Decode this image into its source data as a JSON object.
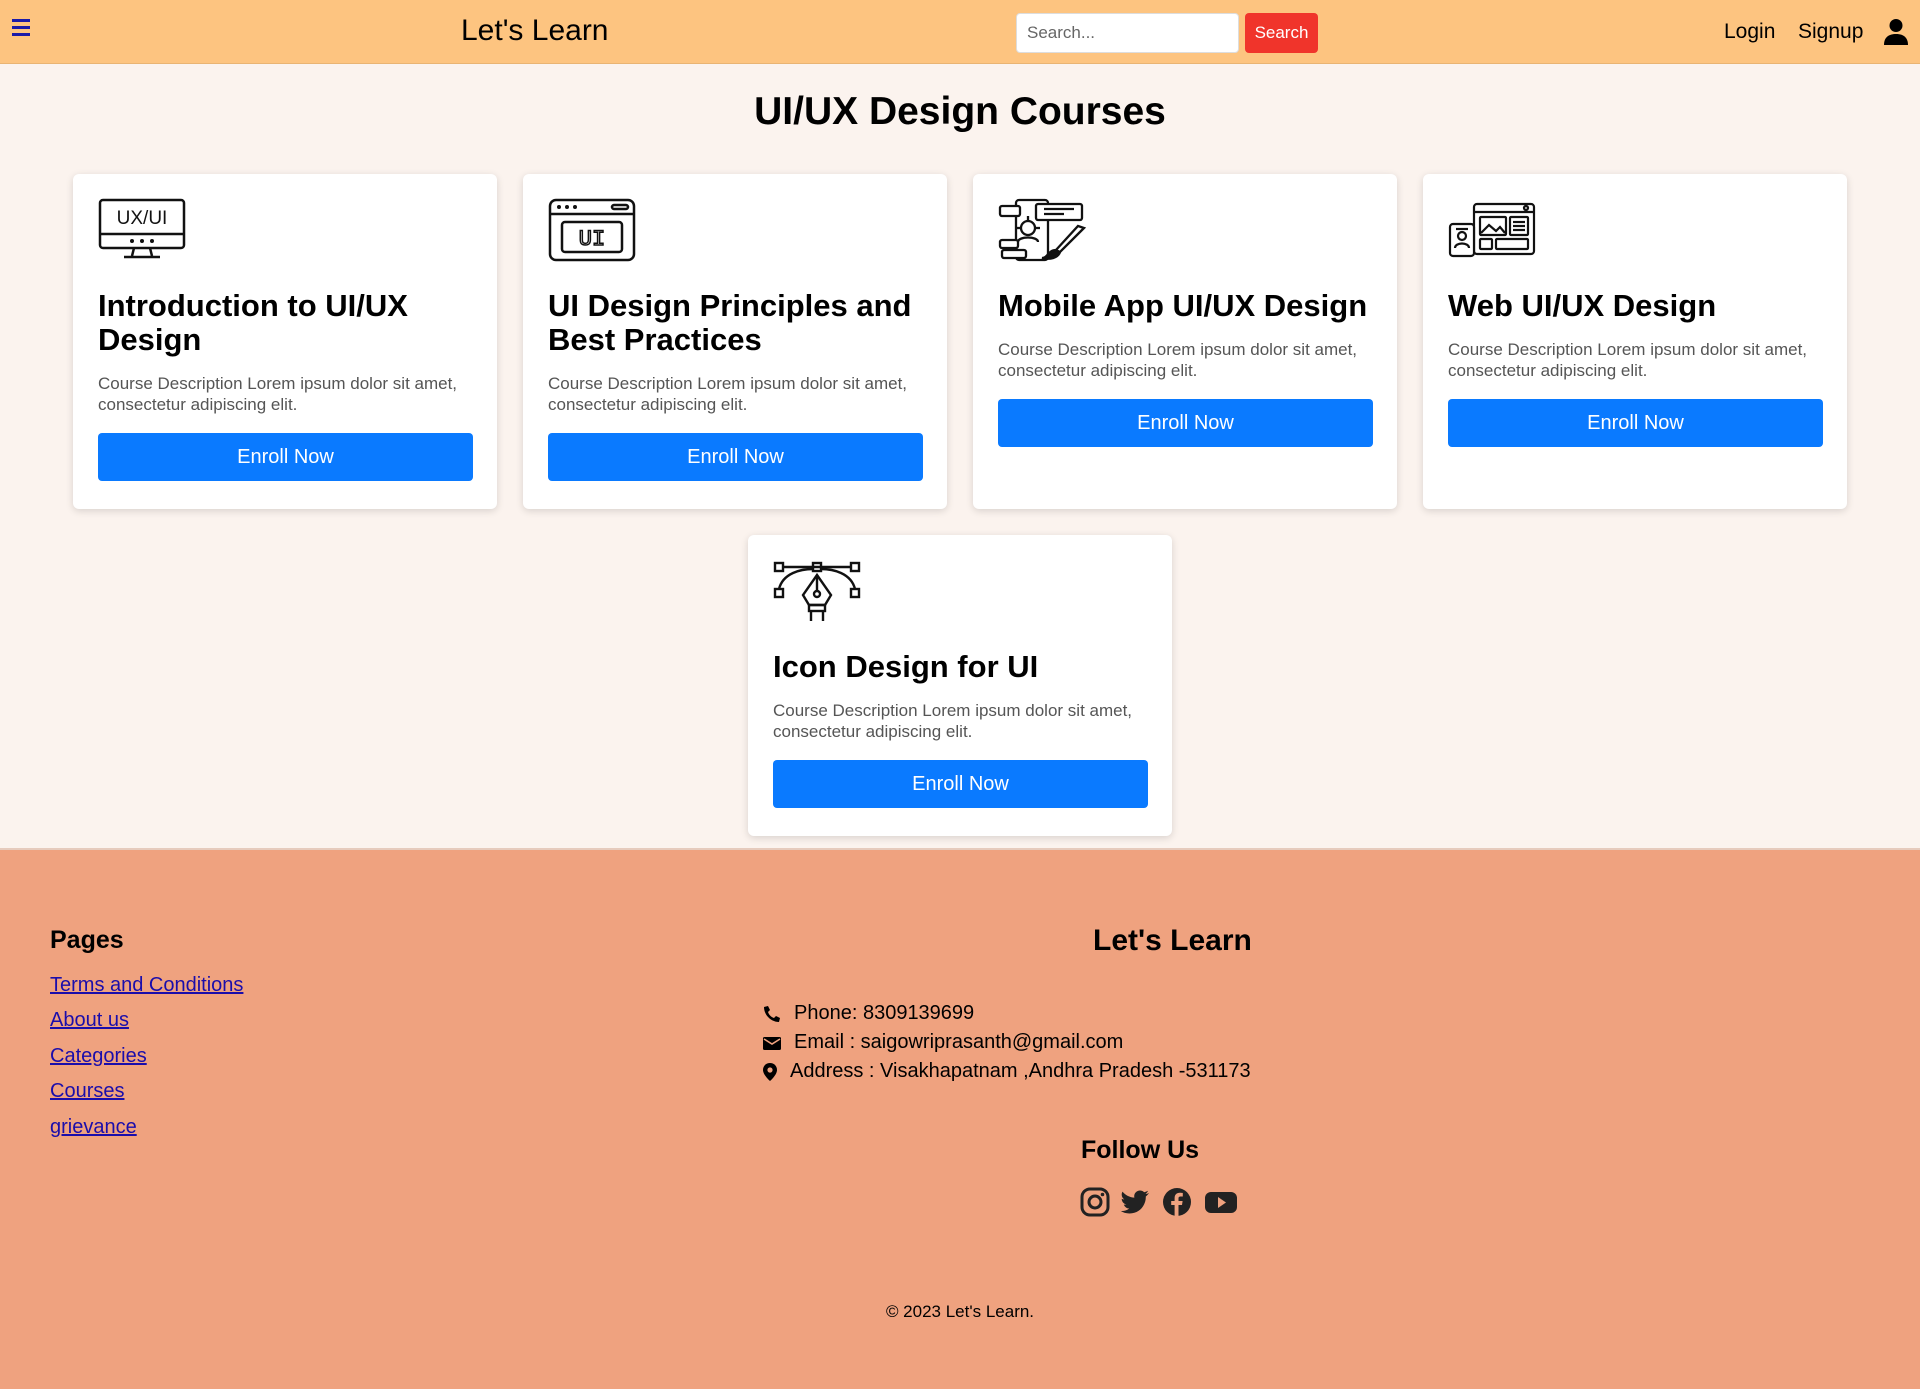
{
  "navbar": {
    "brand": "Let's Learn",
    "search_placeholder": "Search...",
    "search_button": "Search",
    "login": "Login",
    "signup": "Signup",
    "bg_color": "#fdc480"
  },
  "main": {
    "title": "UI/UX Design Courses",
    "courses": [
      {
        "icon": "ux-ui-monitor-icon",
        "title": "Introduction to UI/UX Design",
        "description": "Course Description Lorem ipsum dolor sit amet, consectetur adipiscing elit.",
        "button": "Enroll Now"
      },
      {
        "icon": "ui-browser-window-icon",
        "title": "UI Design Principles and Best Practices",
        "description": "Course Description Lorem ipsum dolor sit amet, consectetur adipiscing elit.",
        "button": "Enroll Now"
      },
      {
        "icon": "mobile-app-design-icon",
        "title": "Mobile App UI/UX Design",
        "description": "Course Description Lorem ipsum dolor sit amet, consectetur adipiscing elit.",
        "button": "Enroll Now"
      },
      {
        "icon": "web-layout-icon",
        "title": "Web UI/UX Design",
        "description": "Course Description Lorem ipsum dolor sit amet, consectetur adipiscing elit.",
        "button": "Enroll Now"
      },
      {
        "icon": "pen-tool-vector-icon",
        "title": "Icon Design for UI",
        "description": "Course Description Lorem ipsum dolor sit amet, consectetur adipiscing elit.",
        "button": "Enroll Now"
      }
    ],
    "button_color": "#0a7aff"
  },
  "footer": {
    "pages_heading": "Pages",
    "pages": [
      "Terms and Conditions",
      "About us",
      "Categories",
      "Courses",
      "grievance"
    ],
    "brand": "Let's Learn",
    "phone": "Phone: 8309139699",
    "email": "Email : saigowriprasanth@gmail.com",
    "address": "Address : Visakhapatnam ,Andhra Pradesh -531173",
    "follow_heading": "Follow Us",
    "socials": [
      "instagram-icon",
      "twitter-icon",
      "facebook-icon",
      "youtube-icon"
    ],
    "copyright": "© 2023 Let's Learn.",
    "bg_color": "#efa27f"
  }
}
